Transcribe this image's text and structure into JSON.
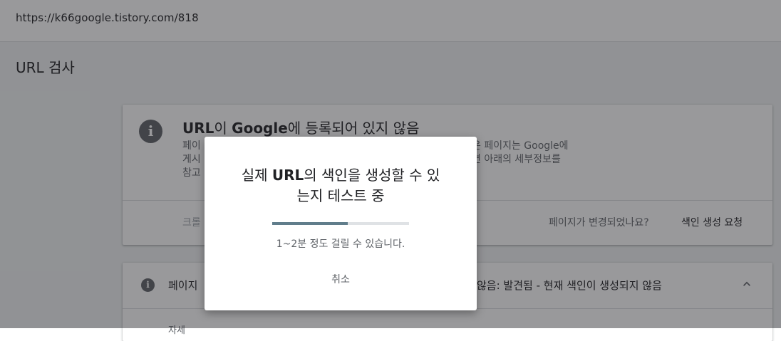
{
  "url_bar": {
    "url": "https://k66google.tistory.com/818"
  },
  "section": {
    "title": "URL 검사"
  },
  "status_card": {
    "icon": "info-icon",
    "title_prefix": "URL",
    "title_mid": "이 ",
    "title_brand": "Google",
    "title_suffix": "에 등록되어 있지 않음",
    "desc_line1_left": "페이",
    "desc_line2_left": "게시",
    "desc_line3_left": "참고",
    "desc_line1_right": "은 페이지는 Google에",
    "desc_line2_right": "면 아래의 세부정보를",
    "crawl_label": "크롤",
    "changed_label": "페이지가 변경되었나요?",
    "request_button": "색인 생성 요청"
  },
  "coverage_card": {
    "icon": "info-icon",
    "left_text": "페이지",
    "right_text": "않음: 발견됨 - 현재 색인이 생성되지 않음",
    "chevron": "chevron-up-icon",
    "detail_label": "자세"
  },
  "dialog": {
    "title_prefix": "실제 ",
    "title_bold": "URL",
    "title_line1_suffix": "의 색인을 생성할 수 있",
    "title_line2": "는지 테스트 중",
    "progress_fraction": 0.55,
    "note": "1~2분 정도 걸릴 수 있습니다.",
    "cancel_label": "취소"
  },
  "colors": {
    "progress_fill": "#607d8b",
    "progress_track": "#dfe2e5",
    "icon_grey": "#5f6368"
  }
}
